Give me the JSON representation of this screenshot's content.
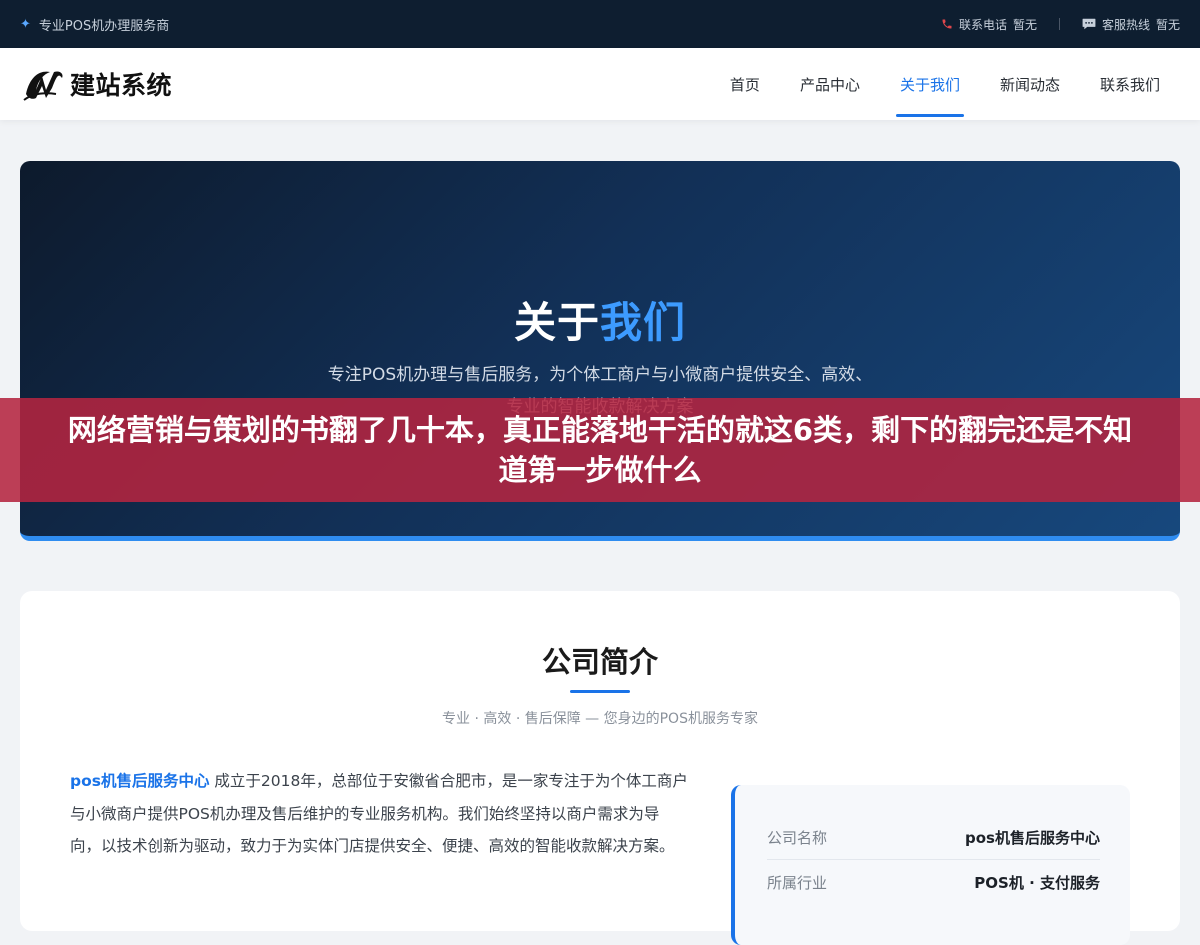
{
  "topbar": {
    "tagline": "专业POS机办理服务商",
    "phone_label": "联系电话",
    "phone_value": "暂无",
    "hotline_label": "客服热线",
    "hotline_value": "暂无"
  },
  "header": {
    "logo_text": "建站系统",
    "nav": [
      {
        "label": "首页"
      },
      {
        "label": "产品中心"
      },
      {
        "label": "关于我们",
        "active": true
      },
      {
        "label": "新闻动态"
      },
      {
        "label": "联系我们"
      }
    ]
  },
  "hero": {
    "title_plain": "关于",
    "title_accent": "我们",
    "desc_line1": "专注POS机办理与售后服务，为个体工商户与小微商户提供安全、高效、",
    "desc_line2": "专业的智能收款解决方案"
  },
  "banner": {
    "text": "网络营销与策划的书翻了几十本，真正能落地干活的就这6类，剩下的翻完还是不知道第一步做什么"
  },
  "intro": {
    "title": "公司简介",
    "subtitle": "专业 · 高效 · 售后保障 — 您身边的POS机服务专家",
    "brand": "pos机售后服务中心",
    "body": " 成立于2018年，总部位于安徽省合肥市，是一家专注于为个体工商户与小微商户提供POS机办理及售后维护的专业服务机构。我们始终坚持以商户需求为导向，以技术创新为驱动，致力于为实体门店提供安全、便捷、高效的智能收款解决方案。",
    "info": [
      {
        "label": "公司名称",
        "value": "pos机售后服务中心"
      },
      {
        "label": "所属行业",
        "value": "POS机 · 支付服务"
      }
    ]
  },
  "colors": {
    "accent": "#1a73e8",
    "topbar_bg": "#0e1e30",
    "banner_bg": "#b42440"
  }
}
